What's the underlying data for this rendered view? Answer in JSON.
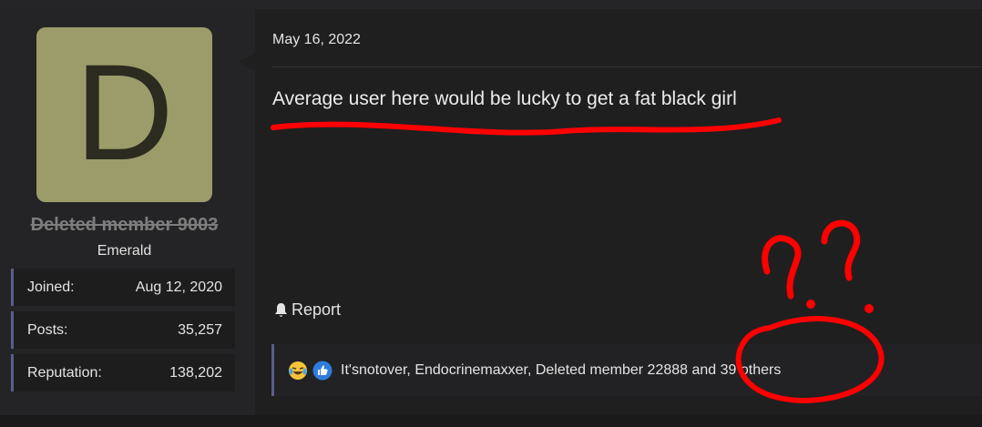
{
  "post": {
    "date": "May 16, 2022",
    "body": "Average user here would be lucky to get a fat black girl",
    "report_label": "Report"
  },
  "user": {
    "avatar_letter": "D",
    "avatar_color": "#9c9c6b",
    "name": "Deleted member 9003",
    "title": "Emerald",
    "stats": [
      {
        "label": "Joined:",
        "value": "Aug 12, 2020"
      },
      {
        "label": "Posts:",
        "value": "35,257"
      },
      {
        "label": "Reputation:",
        "value": "138,202"
      }
    ]
  },
  "reactions": {
    "icons": [
      "crying-laughing-emoji-icon",
      "thumbs-up-icon"
    ],
    "text": "It'snotover, Endocrinemaxxer, Deleted member 22888 and 39 others"
  },
  "annotation": {
    "color": "#ff0000",
    "marks": [
      "underline",
      "question-marks",
      "circle"
    ]
  }
}
